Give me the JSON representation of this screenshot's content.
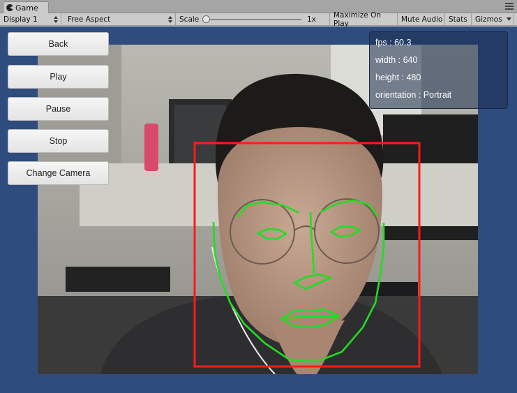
{
  "window": {
    "tab_label": "Game"
  },
  "toolbar": {
    "display": "Display 1",
    "aspect": "Free Aspect",
    "scale_label": "Scale",
    "scale_value": "1x",
    "scale_level": 0,
    "maximize": "Maximize On Play",
    "mute": "Mute Audio",
    "stats": "Stats",
    "gizmos": "Gizmos"
  },
  "buttons": {
    "back": "Back",
    "play": "Play",
    "pause": "Pause",
    "stop": "Stop",
    "change_camera": "Change Camera"
  },
  "info": {
    "fps": "fps : 60.3",
    "width": "width : 640",
    "height": "height : 480",
    "orientation": "orientation : Portrait"
  },
  "colors": {
    "game_background": "#2e4c7e",
    "face_rect": "#ff1a1a",
    "landmarks": "#22dd22"
  }
}
